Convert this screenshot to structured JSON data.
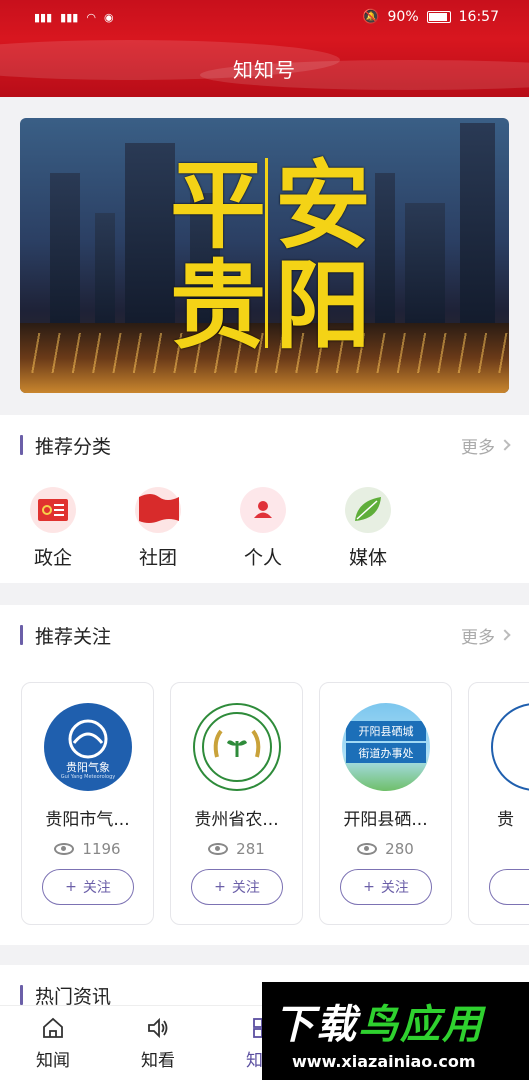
{
  "status_bar": {
    "battery": "90%",
    "time": "16:57"
  },
  "header": {
    "title": "知知号"
  },
  "banner": {
    "line1_left": "平",
    "line1_right": "安",
    "line2_left": "贵",
    "line2_right": "阳"
  },
  "recommend_categories": {
    "title": "推荐分类",
    "more": "更多",
    "items": [
      {
        "label": "政企",
        "icon": "government-flag-icon"
      },
      {
        "label": "社团",
        "icon": "red-flag-icon"
      },
      {
        "label": "个人",
        "icon": "person-icon"
      },
      {
        "label": "媒体",
        "icon": "leaf-icon"
      }
    ]
  },
  "recommend_follow": {
    "title": "推荐关注",
    "more": "更多",
    "follow_label": "关注",
    "cards": [
      {
        "name": "贵阳市气...",
        "views": "1196",
        "avatar_text": "贵阳气象",
        "avatar_sub": "Gui Yang Meteorology"
      },
      {
        "name": "贵州省农...",
        "views": "281"
      },
      {
        "name": "开阳县硒...",
        "views": "280",
        "avatar_text_1": "开阳县硒城",
        "avatar_text_2": "街道办事处"
      },
      {
        "name": "贵",
        "views": ""
      }
    ]
  },
  "hot_news": {
    "title": "热门资讯"
  },
  "bottom_nav": [
    {
      "label": "知闻",
      "icon": "home-icon"
    },
    {
      "label": "知看",
      "icon": "speaker-icon"
    },
    {
      "label": "知知",
      "icon": "grid-icon"
    }
  ],
  "watermark": {
    "brand_part1": "下载",
    "brand_part2": "鸟应用",
    "url": "www.xiazainiao.com"
  }
}
